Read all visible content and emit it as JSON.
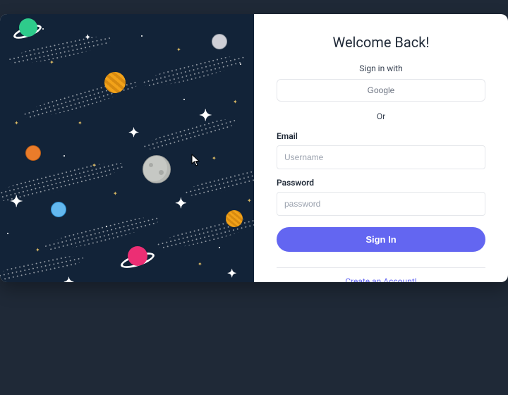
{
  "title": "Welcome Back!",
  "signin_with_label": "Sign in with",
  "oauth": {
    "google": "Google"
  },
  "or_label": "Or",
  "email": {
    "label": "Email",
    "placeholder": "Username",
    "value": ""
  },
  "password": {
    "label": "Password",
    "placeholder": "password",
    "value": ""
  },
  "submit_label": "Sign In",
  "create_account_label": "Create an Account!",
  "colors": {
    "accent": "#6366f1",
    "link": "#6366f1",
    "page_bg": "#1f2937",
    "space_bg": "#122338"
  }
}
